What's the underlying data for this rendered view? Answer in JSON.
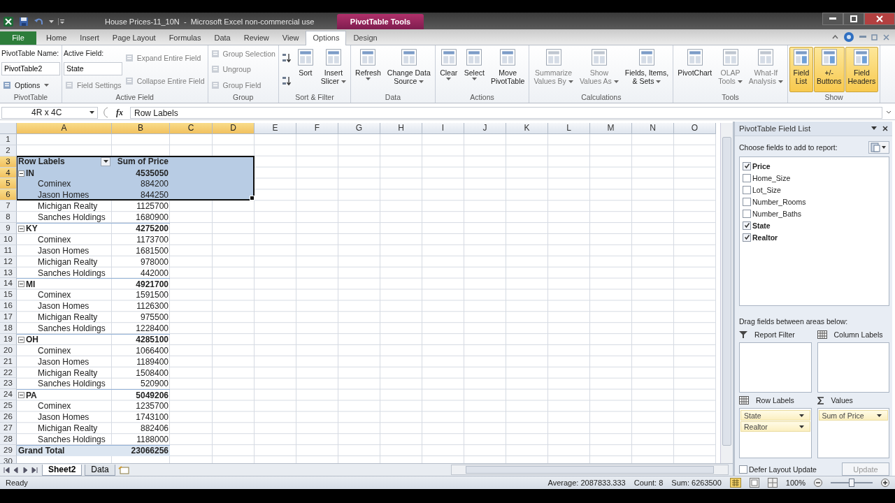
{
  "title_bar": {
    "title": "House Prices-11_10N  -  Microsoft Excel non-commercial use",
    "context_tab": "PivotTable Tools"
  },
  "ribbon_tabs": [
    {
      "label": "File",
      "kind": "file",
      "selected": false
    },
    {
      "label": "Home",
      "kind": "tab",
      "selected": false
    },
    {
      "label": "Insert",
      "kind": "tab",
      "selected": false
    },
    {
      "label": "Page Layout",
      "kind": "tab",
      "selected": false
    },
    {
      "label": "Formulas",
      "kind": "tab",
      "selected": false
    },
    {
      "label": "Data",
      "kind": "tab",
      "selected": false
    },
    {
      "label": "Review",
      "kind": "tab",
      "selected": false
    },
    {
      "label": "View",
      "kind": "tab",
      "selected": false
    },
    {
      "label": "Options",
      "kind": "context",
      "selected": true
    },
    {
      "label": "Design",
      "kind": "context",
      "selected": false
    }
  ],
  "ribbon_groups": [
    {
      "label": "PivotTable",
      "columns": [
        {
          "kind": "stack",
          "items": [
            {
              "kind": "label",
              "text": "PivotTable Name:"
            },
            {
              "kind": "field",
              "value": "PivotTable2"
            },
            {
              "kind": "button",
              "text": "Options",
              "menu": true,
              "disabled": false
            }
          ]
        }
      ]
    },
    {
      "label": "Active Field",
      "columns": [
        {
          "kind": "stack",
          "items": [
            {
              "kind": "label",
              "text": "Active Field:"
            },
            {
              "kind": "field",
              "value": "State"
            },
            {
              "kind": "button",
              "text": "Field Settings",
              "menu": false,
              "disabled": true
            }
          ]
        },
        {
          "kind": "stack",
          "items": [
            {
              "kind": "button",
              "text": "Expand Entire Field",
              "menu": false,
              "disabled": true
            },
            {
              "kind": "button",
              "text": "Collapse Entire Field",
              "menu": false,
              "disabled": true
            }
          ]
        }
      ]
    },
    {
      "label": "Group",
      "columns": [
        {
          "kind": "stack",
          "items": [
            {
              "kind": "button",
              "text": "Group Selection",
              "menu": false,
              "disabled": true
            },
            {
              "kind": "button",
              "text": "Ungroup",
              "menu": false,
              "disabled": true
            },
            {
              "kind": "button",
              "text": "Group Field",
              "menu": false,
              "disabled": true
            }
          ]
        }
      ]
    },
    {
      "label": "Sort & Filter",
      "columns": [
        {
          "kind": "stack",
          "items": [
            {
              "kind": "icon"
            },
            {
              "kind": "icon"
            }
          ]
        },
        {
          "kind": "large",
          "lines": [
            "Sort"
          ],
          "menu": false,
          "pressed": false,
          "disabled": false
        },
        {
          "kind": "large",
          "lines": [
            "Insert",
            "Slicer"
          ],
          "menu": true,
          "pressed": false,
          "disabled": false
        }
      ]
    },
    {
      "label": "Data",
      "columns": [
        {
          "kind": "large",
          "lines": [
            "Refresh"
          ],
          "menu": true,
          "pressed": false,
          "disabled": false
        },
        {
          "kind": "large",
          "lines": [
            "Change Data",
            "Source"
          ],
          "menu": true,
          "pressed": false,
          "disabled": false
        }
      ]
    },
    {
      "label": "Actions",
      "columns": [
        {
          "kind": "large",
          "lines": [
            "Clear"
          ],
          "menu": true,
          "pressed": false,
          "disabled": false
        },
        {
          "kind": "large",
          "lines": [
            "Select"
          ],
          "menu": true,
          "pressed": false,
          "disabled": false
        },
        {
          "kind": "large",
          "lines": [
            "Move",
            "PivotTable"
          ],
          "menu": false,
          "pressed": false,
          "disabled": false
        }
      ]
    },
    {
      "label": "Calculations",
      "columns": [
        {
          "kind": "large",
          "lines": [
            "Summarize",
            "Values By"
          ],
          "menu": true,
          "pressed": false,
          "disabled": true
        },
        {
          "kind": "large",
          "lines": [
            "Show",
            "Values As"
          ],
          "menu": true,
          "pressed": false,
          "disabled": true
        },
        {
          "kind": "large",
          "lines": [
            "Fields, Items,",
            "& Sets"
          ],
          "menu": true,
          "pressed": false,
          "disabled": false
        }
      ]
    },
    {
      "label": "Tools",
      "columns": [
        {
          "kind": "large",
          "lines": [
            "PivotChart"
          ],
          "menu": false,
          "pressed": false,
          "disabled": false
        },
        {
          "kind": "large",
          "lines": [
            "OLAP",
            "Tools"
          ],
          "menu": true,
          "pressed": false,
          "disabled": true
        },
        {
          "kind": "large",
          "lines": [
            "What-If",
            "Analysis"
          ],
          "menu": true,
          "pressed": false,
          "disabled": true
        }
      ]
    },
    {
      "label": "Show",
      "columns": [
        {
          "kind": "large",
          "lines": [
            "Field",
            "List"
          ],
          "menu": false,
          "pressed": true,
          "disabled": false
        },
        {
          "kind": "large",
          "lines": [
            "+/-",
            "Buttons"
          ],
          "menu": false,
          "pressed": true,
          "disabled": false
        },
        {
          "kind": "large",
          "lines": [
            "Field",
            "Headers"
          ],
          "menu": false,
          "pressed": true,
          "disabled": false
        }
      ]
    }
  ],
  "formula_bar": {
    "name_box": "4R x 4C",
    "function_label": "fx",
    "value": "Row Labels"
  },
  "columns": [
    {
      "label": "A",
      "selected": true
    },
    {
      "label": "B",
      "selected": true
    },
    {
      "label": "C",
      "selected": true
    },
    {
      "label": "D",
      "selected": true
    },
    {
      "label": "E",
      "selected": false
    },
    {
      "label": "F",
      "selected": false
    },
    {
      "label": "G",
      "selected": false
    },
    {
      "label": "H",
      "selected": false
    },
    {
      "label": "I",
      "selected": false
    },
    {
      "label": "J",
      "selected": false
    },
    {
      "label": "K",
      "selected": false
    },
    {
      "label": "L",
      "selected": false
    },
    {
      "label": "M",
      "selected": false
    },
    {
      "label": "N",
      "selected": false
    },
    {
      "label": "O",
      "selected": false
    }
  ],
  "rows": [
    {
      "number": "1",
      "selected": false,
      "kind": "empty"
    },
    {
      "number": "2",
      "selected": false,
      "kind": "empty"
    },
    {
      "number": "3",
      "selected": true,
      "kind": "header",
      "label": "Row Labels",
      "value": "Sum of Price"
    },
    {
      "number": "4",
      "selected": true,
      "kind": "group",
      "label": "IN",
      "value": "4535050",
      "expanded": true
    },
    {
      "number": "5",
      "selected": true,
      "kind": "item",
      "label": "Cominex",
      "value": "884200"
    },
    {
      "number": "6",
      "selected": true,
      "kind": "item",
      "label": "Jason Homes",
      "value": "844250"
    },
    {
      "number": "7",
      "selected": false,
      "kind": "item",
      "label": "Michigan Realty",
      "value": "1125700"
    },
    {
      "number": "8",
      "selected": false,
      "kind": "item",
      "label": "Sanches Holdings",
      "value": "1680900"
    },
    {
      "number": "9",
      "selected": false,
      "kind": "group",
      "label": "KY",
      "value": "4275200",
      "expanded": true
    },
    {
      "number": "10",
      "selected": false,
      "kind": "item",
      "label": "Cominex",
      "value": "1173700"
    },
    {
      "number": "11",
      "selected": false,
      "kind": "item",
      "label": "Jason Homes",
      "value": "1681500"
    },
    {
      "number": "12",
      "selected": false,
      "kind": "item",
      "label": "Michigan Realty",
      "value": "978000"
    },
    {
      "number": "13",
      "selected": false,
      "kind": "item",
      "label": "Sanches Holdings",
      "value": "442000"
    },
    {
      "number": "14",
      "selected": false,
      "kind": "group",
      "label": "MI",
      "value": "4921700",
      "expanded": true
    },
    {
      "number": "15",
      "selected": false,
      "kind": "item",
      "label": "Cominex",
      "value": "1591500"
    },
    {
      "number": "16",
      "selected": false,
      "kind": "item",
      "label": "Jason Homes",
      "value": "1126300"
    },
    {
      "number": "17",
      "selected": false,
      "kind": "item",
      "label": "Michigan Realty",
      "value": "975500"
    },
    {
      "number": "18",
      "selected": false,
      "kind": "item",
      "label": "Sanches Holdings",
      "value": "1228400"
    },
    {
      "number": "19",
      "selected": false,
      "kind": "group",
      "label": "OH",
      "value": "4285100",
      "expanded": true
    },
    {
      "number": "20",
      "selected": false,
      "kind": "item",
      "label": "Cominex",
      "value": "1066400"
    },
    {
      "number": "21",
      "selected": false,
      "kind": "item",
      "label": "Jason Homes",
      "value": "1189400"
    },
    {
      "number": "22",
      "selected": false,
      "kind": "item",
      "label": "Michigan Realty",
      "value": "1508400"
    },
    {
      "number": "23",
      "selected": false,
      "kind": "item",
      "label": "Sanches Holdings",
      "value": "520900"
    },
    {
      "number": "24",
      "selected": false,
      "kind": "group",
      "label": "PA",
      "value": "5049206",
      "expanded": true
    },
    {
      "number": "25",
      "selected": false,
      "kind": "item",
      "label": "Cominex",
      "value": "1235700"
    },
    {
      "number": "26",
      "selected": false,
      "kind": "item",
      "label": "Jason Homes",
      "value": "1743100"
    },
    {
      "number": "27",
      "selected": false,
      "kind": "item",
      "label": "Michigan Realty",
      "value": "882406"
    },
    {
      "number": "28",
      "selected": false,
      "kind": "item",
      "label": "Sanches Holdings",
      "value": "1188000"
    },
    {
      "number": "29",
      "selected": false,
      "kind": "total",
      "label": "Grand Total",
      "value": "23066256"
    },
    {
      "number": "30",
      "selected": false,
      "kind": "empty"
    }
  ],
  "sheet_tabs": [
    {
      "label": "Sheet2",
      "selected": true
    },
    {
      "label": "Data",
      "selected": false
    }
  ],
  "field_list": {
    "title": "PivotTable Field List",
    "prompt": "Choose fields to add to report:",
    "fields": [
      {
        "label": "Price",
        "checked": true
      },
      {
        "label": "Home_Size",
        "checked": false
      },
      {
        "label": "Lot_Size",
        "checked": false
      },
      {
        "label": "Number_Rooms",
        "checked": false
      },
      {
        "label": "Number_Baths",
        "checked": false
      },
      {
        "label": "State",
        "checked": true
      },
      {
        "label": "Realtor",
        "checked": true
      }
    ],
    "areas_prompt": "Drag fields between areas below:",
    "areas": [
      {
        "kind": "filter",
        "label": "Report Filter"
      },
      {
        "kind": "columns",
        "label": "Column Labels"
      },
      {
        "kind": "rows",
        "label": "Row Labels",
        "items": [
          "State",
          "Realtor"
        ]
      },
      {
        "kind": "values",
        "label": "Values",
        "items": [
          "Sum of Price"
        ]
      }
    ],
    "defer": {
      "label": "Defer Layout Update",
      "checked": false
    },
    "update": {
      "label": "Update",
      "disabled": true
    }
  },
  "status_bar": {
    "mode": "Ready",
    "average": "Average: 2087833.333",
    "count": "Count: 8",
    "sum": "Sum: 6263500",
    "zoom": "100%",
    "zoom_level": {
      "level": 0.5
    }
  }
}
